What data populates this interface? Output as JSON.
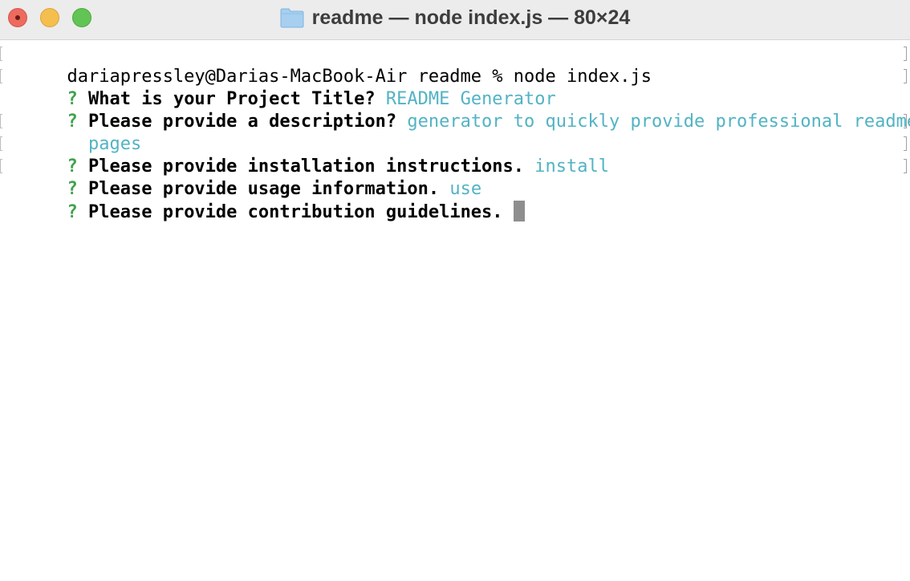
{
  "window": {
    "title": "readme — node index.js — 80×24"
  },
  "terminal": {
    "command_line": "dariapressley@Darias-MacBook-Air readme % node index.js",
    "qmark": "?",
    "lines": [
      {
        "prompt": "What is your Project Title?",
        "answer": "README Generator"
      },
      {
        "prompt": "Please provide a description?",
        "answer": "generator to quickly provide professional readme"
      },
      {
        "continuation": "pages"
      },
      {
        "prompt": "Please provide installation instructions.",
        "answer": "install"
      },
      {
        "prompt": "Please provide usage information.",
        "answer": "use"
      },
      {
        "prompt": "Please provide contribution guidelines.",
        "answer": ""
      }
    ]
  },
  "colors": {
    "qmark": "#3fa34d",
    "answer": "#52b3c4",
    "cursor": "#8e8e8e"
  }
}
